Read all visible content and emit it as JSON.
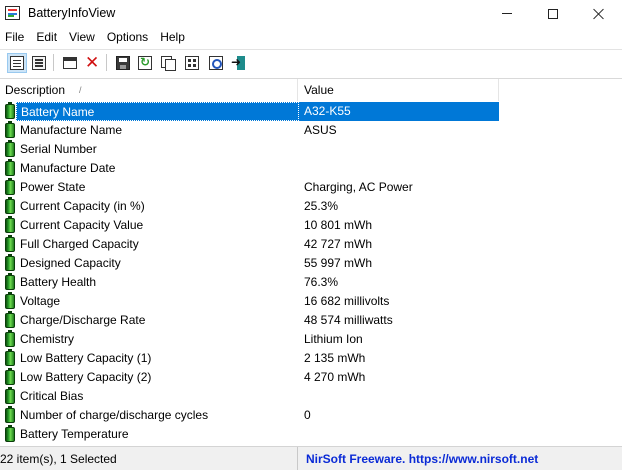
{
  "window": {
    "title": "BatteryInfoView"
  },
  "menu": [
    "File",
    "Edit",
    "View",
    "Options",
    "Help"
  ],
  "toolbar": {
    "icons": [
      "html-report-icon",
      "html-report-all-icon",
      "window-icon",
      "delete-icon",
      "save-icon",
      "refresh-icon",
      "copy-icon",
      "properties-icon",
      "find-icon",
      "exit-icon"
    ]
  },
  "columns": {
    "description": "Description",
    "value": "Value",
    "sort_arrow": "/"
  },
  "rows": [
    {
      "description": "Battery Name",
      "value": "A32-K55",
      "selected": true
    },
    {
      "description": "Manufacture Name",
      "value": "ASUS"
    },
    {
      "description": "Serial Number",
      "value": ""
    },
    {
      "description": "Manufacture Date",
      "value": ""
    },
    {
      "description": "Power State",
      "value": "Charging, AC Power"
    },
    {
      "description": "Current Capacity (in %)",
      "value": "25.3%"
    },
    {
      "description": "Current Capacity Value",
      "value": "10 801 mWh"
    },
    {
      "description": "Full Charged Capacity",
      "value": "42 727 mWh"
    },
    {
      "description": "Designed Capacity",
      "value": "55 997 mWh"
    },
    {
      "description": "Battery Health",
      "value": "76.3%"
    },
    {
      "description": "Voltage",
      "value": "16 682 millivolts"
    },
    {
      "description": "Charge/Discharge Rate",
      "value": "48 574 milliwatts"
    },
    {
      "description": "Chemistry",
      "value": "Lithium Ion"
    },
    {
      "description": "Low Battery Capacity (1)",
      "value": "2 135 mWh"
    },
    {
      "description": "Low Battery Capacity (2)",
      "value": "4 270 mWh"
    },
    {
      "description": "Critical Bias",
      "value": ""
    },
    {
      "description": "Number of charge/discharge cycles",
      "value": "0"
    },
    {
      "description": "Battery Temperature",
      "value": ""
    }
  ],
  "status": {
    "items": "22 item(s), 1 Selected",
    "credit": "NirSoft Freeware. https://www.nirsoft.net"
  },
  "colors": {
    "selection": "#0078d7",
    "credit": "#0a2ad6"
  }
}
